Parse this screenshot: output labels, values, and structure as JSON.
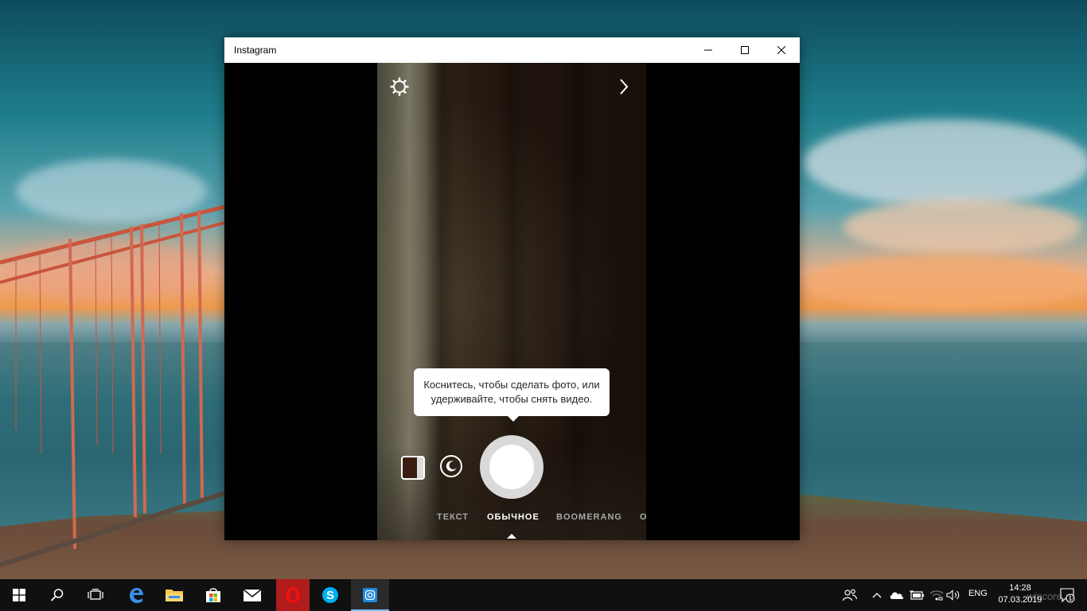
{
  "window": {
    "title": "Instagram",
    "controls": {
      "minimize": "minimize-icon",
      "maximize": "maximize-icon",
      "close": "close-icon"
    }
  },
  "camera": {
    "top_left_icon": "settings-gear-icon",
    "top_right_icon": "chevron-right-icon",
    "tooltip": "Коснитесь, чтобы сделать фото, или удерживайте, чтобы снять видео.",
    "modes": [
      {
        "label": "ТЕКСТ",
        "active": false
      },
      {
        "label": "ОБЫЧНОЕ",
        "active": true
      },
      {
        "label": "BOOMERANG",
        "active": false
      },
      {
        "label": "О",
        "active": false
      }
    ]
  },
  "taskbar": {
    "items": [
      {
        "name": "start-icon",
        "active": false
      },
      {
        "name": "search-icon",
        "active": false
      },
      {
        "name": "task-view-icon",
        "active": false
      },
      {
        "name": "edge-icon",
        "active": false
      },
      {
        "name": "file-explorer-icon",
        "active": false
      },
      {
        "name": "store-icon",
        "active": false
      },
      {
        "name": "mail-icon",
        "active": false
      },
      {
        "name": "opera-icon",
        "active": false
      },
      {
        "name": "skype-icon",
        "active": false
      },
      {
        "name": "instagram-icon",
        "active": true
      }
    ],
    "tray": {
      "language": "ENG",
      "time": "14:28",
      "date": "07.03.2019",
      "notifications_count": "1"
    }
  },
  "watermark": "wincore.ru",
  "colors": {
    "taskbar": "#101010",
    "active_indicator": "#76b9ed",
    "shutter_ring": "#d9d9d9"
  }
}
